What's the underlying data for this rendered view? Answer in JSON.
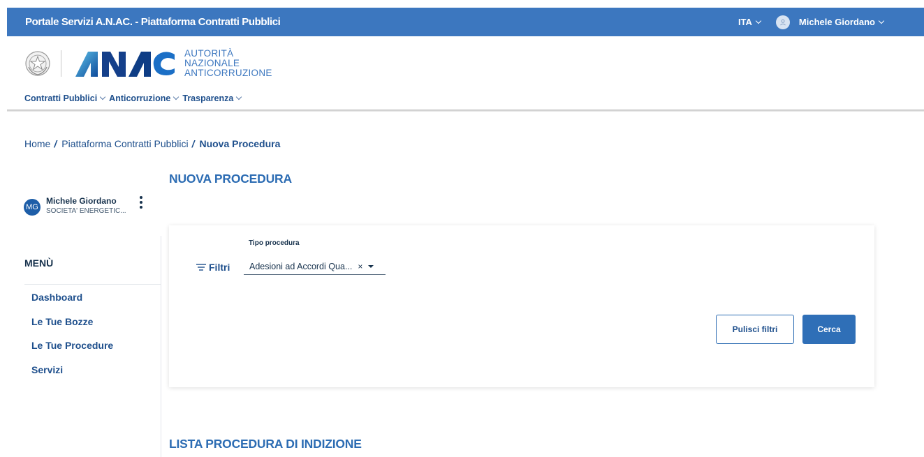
{
  "topbar": {
    "title": "Portale Servizi A.N.AC. - Piattaforma Contratti Pubblici",
    "language": "ITA",
    "user_name": "Michele Giordano",
    "color": "#3c77bf"
  },
  "logo": {
    "line1": "AUTORITÀ",
    "line2": "NAZIONALE",
    "line3": "ANTICORRUZIONE",
    "mark_text": "ANAC"
  },
  "mainnav": {
    "items": [
      {
        "label": "Contratti Pubblici"
      },
      {
        "label": "Anticorruzione"
      },
      {
        "label": "Trasparenza"
      }
    ]
  },
  "breadcrumb": {
    "items": [
      "Home",
      "Piattaforma Contratti Pubblici",
      "Nuova Procedura"
    ],
    "separator": "/"
  },
  "page": {
    "title": "NUOVA PROCEDURA",
    "list_title": "LISTA PROCEDURA DI INDIZIONE"
  },
  "profile": {
    "initials": "MG",
    "name": "Michele Giordano",
    "organization": "SOCIETA' ENERGETIC..."
  },
  "sidebar": {
    "menu_title": "MENÙ",
    "items": [
      {
        "label": "Dashboard"
      },
      {
        "label": "Le Tue Bozze"
      },
      {
        "label": "Le Tue Procedure"
      },
      {
        "label": "Servizi"
      }
    ]
  },
  "filters": {
    "toggle_label": "Filtri",
    "tipo_procedura_label": "Tipo procedura",
    "tipo_procedura_value": "Adesioni ad Accordi Qua...",
    "clear_symbol": "×",
    "reset_label": "Pulisci filtri",
    "search_label": "Cerca"
  },
  "icons": {
    "user": "user-icon",
    "filter": "filter-lines-icon",
    "kebab": "vertical-dots-icon",
    "emblem": "italian-republic-emblem-icon"
  }
}
